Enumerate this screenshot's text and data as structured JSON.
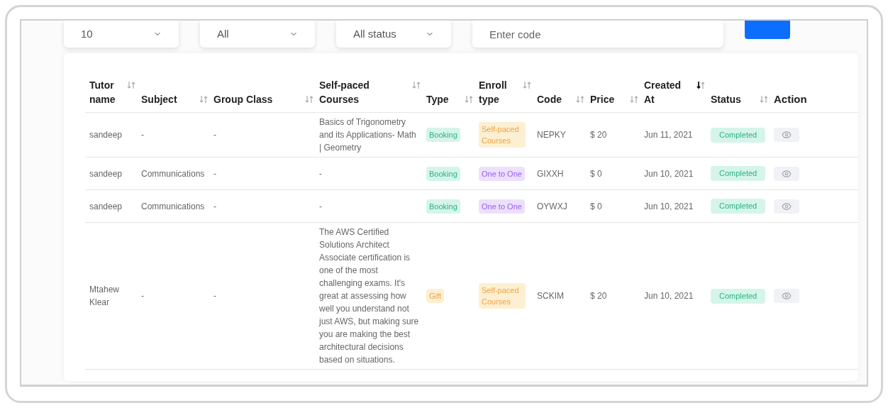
{
  "filters": [
    {
      "kind": "select",
      "value": "10"
    },
    {
      "kind": "select",
      "value": "All"
    },
    {
      "kind": "select",
      "value": "All status"
    },
    {
      "kind": "input",
      "placeholder": "Enter code"
    }
  ],
  "table": {
    "columns": [
      {
        "label": "Tutor name",
        "sortable": true,
        "sorted_desc": false
      },
      {
        "label": "Subject",
        "sortable": true,
        "sorted_desc": false
      },
      {
        "label": "Group Class",
        "sortable": true,
        "sorted_desc": false
      },
      {
        "label": "Self-paced Courses",
        "sortable": true,
        "sorted_desc": false
      },
      {
        "label": "Type",
        "sortable": true,
        "sorted_desc": false
      },
      {
        "label": "Enroll type",
        "sortable": true,
        "sorted_desc": false
      },
      {
        "label": "Code",
        "sortable": true,
        "sorted_desc": false
      },
      {
        "label": "Price",
        "sortable": true,
        "sorted_desc": false
      },
      {
        "label": "Created At",
        "sortable": true,
        "sorted_desc": true
      },
      {
        "label": "Status",
        "sortable": true,
        "sorted_desc": false
      },
      {
        "label": "Action",
        "sortable": false,
        "sorted_desc": false
      }
    ],
    "rows": [
      {
        "tutor": "sandeep",
        "subject": "-",
        "group_class": "-",
        "course": "Basics of Trigonometry and its Applications- Math | Geometry",
        "type": {
          "label": "Booking",
          "kind": "booking"
        },
        "enroll_type": {
          "label": "Self-paced Courses",
          "kind": "self_paced"
        },
        "code": "NEPKY",
        "price": "$ 20",
        "created_at": "Jun 11, 2021",
        "status": "Completed"
      },
      {
        "tutor": "sandeep",
        "subject": "Communications",
        "group_class": "-",
        "course": "-",
        "type": {
          "label": "Booking",
          "kind": "booking"
        },
        "enroll_type": {
          "label": "One to One",
          "kind": "one_to_one"
        },
        "code": "GIXXH",
        "price": "$ 0",
        "created_at": "Jun 10, 2021",
        "status": "Completed"
      },
      {
        "tutor": "sandeep",
        "subject": "Communications",
        "group_class": "-",
        "course": "-",
        "type": {
          "label": "Booking",
          "kind": "booking"
        },
        "enroll_type": {
          "label": "One to One",
          "kind": "one_to_one"
        },
        "code": "OYWXJ",
        "price": "$ 0",
        "created_at": "Jun 10, 2021",
        "status": "Completed"
      },
      {
        "tutor": "Mtahew Klear",
        "subject": "-",
        "group_class": "-",
        "course": "The AWS Certified Solutions Architect Associate certification is one of the most challenging exams. It's great at assessing how well you understand not just AWS, but making sure you are making the best architectural decisions based on situations.",
        "type": {
          "label": "Gift",
          "kind": "gift"
        },
        "enroll_type": {
          "label": "Self-paced Courses",
          "kind": "self_paced"
        },
        "code": "SCKIM",
        "price": "$ 20",
        "created_at": "Jun 10, 2021",
        "status": "Completed"
      }
    ]
  }
}
